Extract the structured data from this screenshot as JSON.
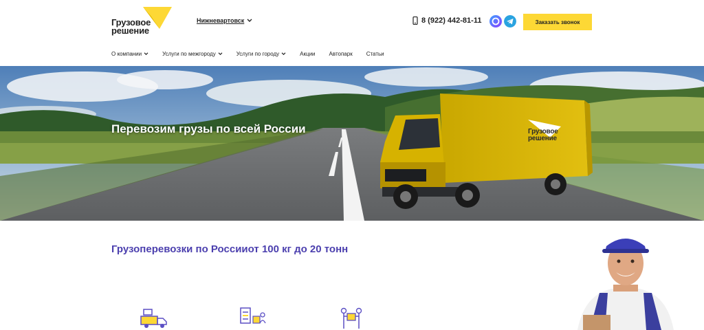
{
  "header": {
    "logo_line1": "Грузовое",
    "logo_line2": "решение",
    "city": "Нижневартовск",
    "phone": "8 (922) 442-81-11",
    "callback_label": "Заказать звонок"
  },
  "nav": {
    "items": [
      {
        "label": "О компании",
        "dropdown": true
      },
      {
        "label": "Услуги по межгороду",
        "dropdown": true
      },
      {
        "label": "Услуги по городу",
        "dropdown": true
      },
      {
        "label": "Акции",
        "dropdown": false
      },
      {
        "label": "Автопарк",
        "dropdown": false
      },
      {
        "label": "Статьи",
        "dropdown": false
      }
    ]
  },
  "hero": {
    "title": "Перевозим грузы по всей России",
    "truck_logo_line1": "Грузовое",
    "truck_logo_line2": "решение"
  },
  "content": {
    "section_title": "Грузоперевозки по Россииот 100 кг до 20 тонн"
  },
  "colors": {
    "accent": "#fdd835",
    "title": "#4b3fae",
    "icon": "#5b4fc4"
  },
  "icons": [
    "phone-icon",
    "max-messenger-icon",
    "telegram-icon",
    "chevron-down-icon",
    "truck-icon",
    "checklist-icon",
    "mover-icon"
  ]
}
